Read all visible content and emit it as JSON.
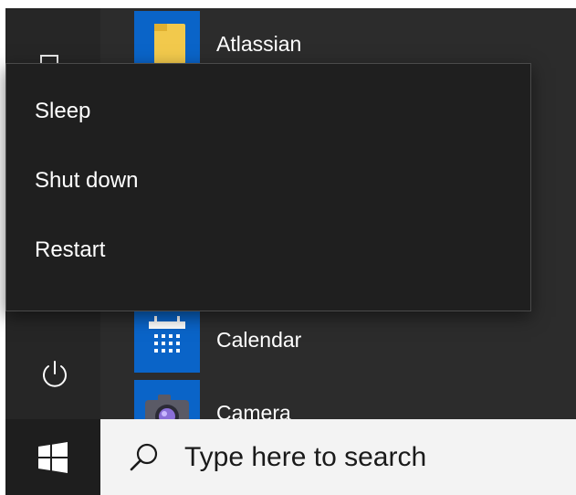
{
  "apps": {
    "atlassian": {
      "label": "Atlassian",
      "icon": "folder-icon",
      "color": "#0a64c8"
    },
    "calendar": {
      "label": "Calendar",
      "icon": "calendar-icon",
      "color": "#0a64c8"
    },
    "camera": {
      "label": "Camera",
      "icon": "camera-icon",
      "color": "#0a64c8"
    }
  },
  "power_menu": {
    "items": [
      {
        "label": "Sleep"
      },
      {
        "label": "Shut down"
      },
      {
        "label": "Restart"
      }
    ]
  },
  "rail": {
    "document_icon": "document-icon",
    "power_icon": "power-icon"
  },
  "taskbar": {
    "start_icon": "windows-logo-icon",
    "search": {
      "icon": "search-icon",
      "placeholder": "Type here to search"
    }
  },
  "colors": {
    "menu_background": "#2c2c2c",
    "flyout_background": "#1f1f1f",
    "tile_accent": "#0a64c8",
    "search_background": "#f3f3f3"
  }
}
